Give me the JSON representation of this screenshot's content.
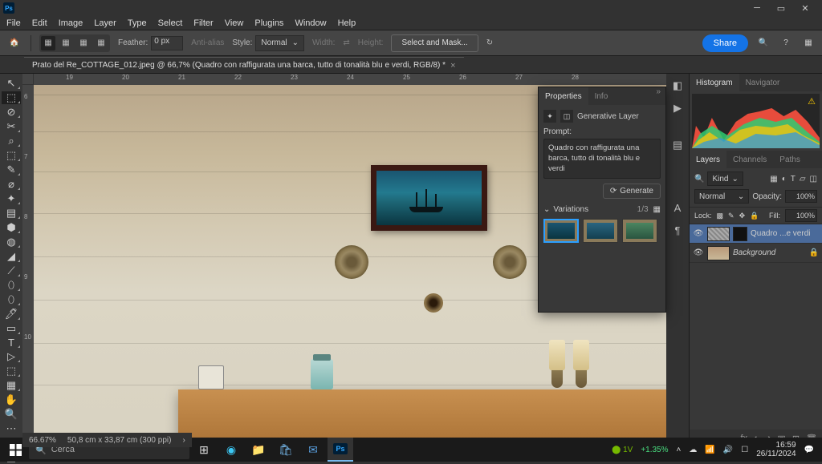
{
  "menu": [
    "File",
    "Edit",
    "Image",
    "Layer",
    "Type",
    "Select",
    "Filter",
    "View",
    "Plugins",
    "Window",
    "Help"
  ],
  "options": {
    "feather_label": "Feather:",
    "feather_val": "0 px",
    "antialias": "Anti-alias",
    "style_label": "Style:",
    "style_val": "Normal",
    "width_label": "Width:",
    "height_label": "Height:",
    "selectmask": "Select and Mask...",
    "share": "Share"
  },
  "doc": {
    "tab": "Prato del Re_COTTAGE_012.jpeg @ 66,7% (Quadro con raffigurata una barca, tutto di tonalità blu e verdi, RGB/8) *",
    "zoom": "66.67%",
    "dims": "50,8 cm x 33,87 cm (300 ppi)"
  },
  "ruler_h": [
    "19",
    "20",
    "21",
    "22",
    "23",
    "24",
    "25",
    "26",
    "27",
    "28"
  ],
  "ruler_v": [
    "6",
    "7",
    "8",
    "9",
    "10"
  ],
  "props": {
    "tab1": "Properties",
    "tab2": "Info",
    "genlayer": "Generative Layer",
    "prompt_label": "Prompt:",
    "prompt": "Quadro con raffigurata una barca, tutto di tonalità blu e verdi",
    "generate": "Generate",
    "variations": "Variations",
    "var_count": "1/3"
  },
  "histo": {
    "tab1": "Histogram",
    "tab2": "Navigator"
  },
  "layers": {
    "tab1": "Layers",
    "tab2": "Channels",
    "tab3": "Paths",
    "kind": "Kind",
    "blend": "Normal",
    "opacity_label": "Opacity:",
    "opacity": "100%",
    "lock_label": "Lock:",
    "fill_label": "Fill:",
    "fill": "100%",
    "l1": "Quadro ...e verdi",
    "l2": "Background"
  },
  "taskbar": {
    "search": "Cerca",
    "nv": "1V",
    "perc": "+1.35%",
    "time": "16:59",
    "date": "26/11/2024"
  }
}
